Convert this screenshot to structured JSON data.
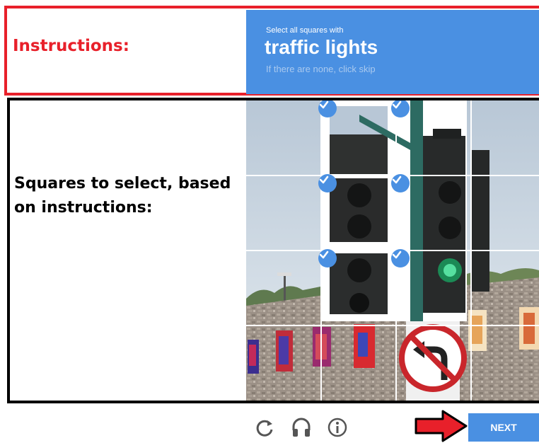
{
  "instructions": {
    "label": "Instructions:"
  },
  "challenge": {
    "prompt_small": "Select all squares with",
    "target": "traffic lights",
    "hint": "If there are none, click skip"
  },
  "squares_label": "Squares to select, based on instructions:",
  "grid": {
    "rows": 4,
    "cols": 4,
    "selected": [
      {
        "row": 0,
        "col": 1
      },
      {
        "row": 0,
        "col": 2
      },
      {
        "row": 1,
        "col": 1
      },
      {
        "row": 1,
        "col": 2
      },
      {
        "row": 2,
        "col": 1
      },
      {
        "row": 2,
        "col": 2
      }
    ]
  },
  "footer": {
    "icons": [
      "reload-icon",
      "headphones-icon",
      "info-icon"
    ],
    "next_label": "NEXT"
  },
  "colors": {
    "accent": "#4a90e2",
    "instructions_border": "#e8202a",
    "squares_border": "#000000",
    "arrow": "#e8202a"
  }
}
